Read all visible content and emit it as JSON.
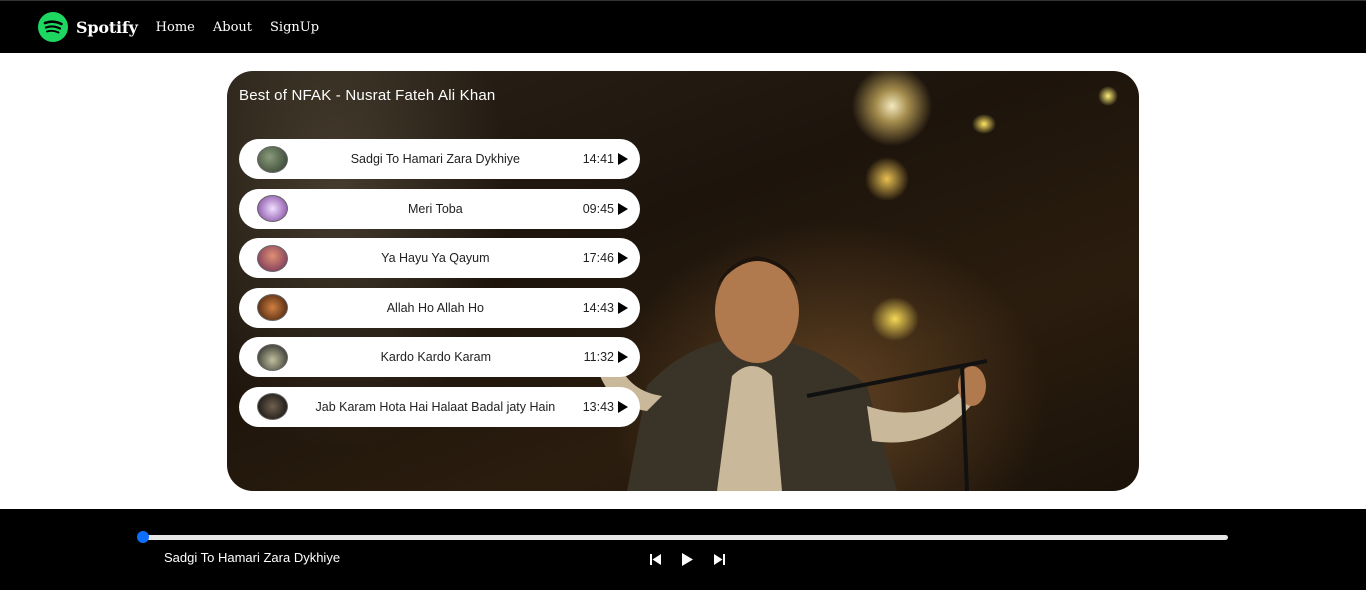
{
  "navbar": {
    "brand": "Spotify",
    "links": [
      {
        "label": "Home"
      },
      {
        "label": "About"
      },
      {
        "label": "SignUp"
      }
    ]
  },
  "playlist": {
    "title": "Best of NFAK - Nusrat Fateh Ali Khan",
    "songs": [
      {
        "name": "Sadgi To Hamari Zara Dykhiye",
        "duration": "14:41",
        "thumb_color": "#3a4a3a"
      },
      {
        "name": "Meri Toba",
        "duration": "09:45",
        "thumb_color": "#7a3b9a"
      },
      {
        "name": "Ya Hayu Ya Qayum",
        "duration": "17:46",
        "thumb_color": "#8a3a6a"
      },
      {
        "name": "Allah Ho Allah Ho",
        "duration": "14:43",
        "thumb_color": "#5a2a1a"
      },
      {
        "name": "Kardo Kardo Karam",
        "duration": "11:32",
        "thumb_color": "#2a2a2a"
      },
      {
        "name": "Jab Karam Hota Hai Halaat Badal jaty Hain",
        "duration": "13:43",
        "thumb_color": "#1a1a1a"
      }
    ]
  },
  "player": {
    "now_playing": "Sadgi To Hamari Zara Dykhiye",
    "progress": 0
  },
  "colors": {
    "brand_green": "#1ed760",
    "accent_blue": "#0d6efd"
  },
  "icons": {
    "logo": "spotify-logo-icon",
    "play": "play-icon",
    "previous": "skip-previous-icon",
    "next": "skip-next-icon"
  }
}
